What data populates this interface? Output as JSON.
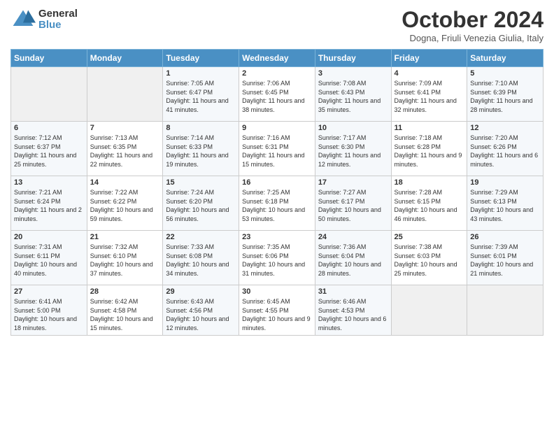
{
  "header": {
    "logo": {
      "general": "General",
      "blue": "Blue"
    },
    "title": "October 2024",
    "subtitle": "Dogna, Friuli Venezia Giulia, Italy"
  },
  "weekdays": [
    "Sunday",
    "Monday",
    "Tuesday",
    "Wednesday",
    "Thursday",
    "Friday",
    "Saturday"
  ],
  "weeks": [
    [
      {
        "day": "",
        "content": ""
      },
      {
        "day": "",
        "content": ""
      },
      {
        "day": "1",
        "content": "Sunrise: 7:05 AM\nSunset: 6:47 PM\nDaylight: 11 hours and 41 minutes."
      },
      {
        "day": "2",
        "content": "Sunrise: 7:06 AM\nSunset: 6:45 PM\nDaylight: 11 hours and 38 minutes."
      },
      {
        "day": "3",
        "content": "Sunrise: 7:08 AM\nSunset: 6:43 PM\nDaylight: 11 hours and 35 minutes."
      },
      {
        "day": "4",
        "content": "Sunrise: 7:09 AM\nSunset: 6:41 PM\nDaylight: 11 hours and 32 minutes."
      },
      {
        "day": "5",
        "content": "Sunrise: 7:10 AM\nSunset: 6:39 PM\nDaylight: 11 hours and 28 minutes."
      }
    ],
    [
      {
        "day": "6",
        "content": "Sunrise: 7:12 AM\nSunset: 6:37 PM\nDaylight: 11 hours and 25 minutes."
      },
      {
        "day": "7",
        "content": "Sunrise: 7:13 AM\nSunset: 6:35 PM\nDaylight: 11 hours and 22 minutes."
      },
      {
        "day": "8",
        "content": "Sunrise: 7:14 AM\nSunset: 6:33 PM\nDaylight: 11 hours and 19 minutes."
      },
      {
        "day": "9",
        "content": "Sunrise: 7:16 AM\nSunset: 6:31 PM\nDaylight: 11 hours and 15 minutes."
      },
      {
        "day": "10",
        "content": "Sunrise: 7:17 AM\nSunset: 6:30 PM\nDaylight: 11 hours and 12 minutes."
      },
      {
        "day": "11",
        "content": "Sunrise: 7:18 AM\nSunset: 6:28 PM\nDaylight: 11 hours and 9 minutes."
      },
      {
        "day": "12",
        "content": "Sunrise: 7:20 AM\nSunset: 6:26 PM\nDaylight: 11 hours and 6 minutes."
      }
    ],
    [
      {
        "day": "13",
        "content": "Sunrise: 7:21 AM\nSunset: 6:24 PM\nDaylight: 11 hours and 2 minutes."
      },
      {
        "day": "14",
        "content": "Sunrise: 7:22 AM\nSunset: 6:22 PM\nDaylight: 10 hours and 59 minutes."
      },
      {
        "day": "15",
        "content": "Sunrise: 7:24 AM\nSunset: 6:20 PM\nDaylight: 10 hours and 56 minutes."
      },
      {
        "day": "16",
        "content": "Sunrise: 7:25 AM\nSunset: 6:18 PM\nDaylight: 10 hours and 53 minutes."
      },
      {
        "day": "17",
        "content": "Sunrise: 7:27 AM\nSunset: 6:17 PM\nDaylight: 10 hours and 50 minutes."
      },
      {
        "day": "18",
        "content": "Sunrise: 7:28 AM\nSunset: 6:15 PM\nDaylight: 10 hours and 46 minutes."
      },
      {
        "day": "19",
        "content": "Sunrise: 7:29 AM\nSunset: 6:13 PM\nDaylight: 10 hours and 43 minutes."
      }
    ],
    [
      {
        "day": "20",
        "content": "Sunrise: 7:31 AM\nSunset: 6:11 PM\nDaylight: 10 hours and 40 minutes."
      },
      {
        "day": "21",
        "content": "Sunrise: 7:32 AM\nSunset: 6:10 PM\nDaylight: 10 hours and 37 minutes."
      },
      {
        "day": "22",
        "content": "Sunrise: 7:33 AM\nSunset: 6:08 PM\nDaylight: 10 hours and 34 minutes."
      },
      {
        "day": "23",
        "content": "Sunrise: 7:35 AM\nSunset: 6:06 PM\nDaylight: 10 hours and 31 minutes."
      },
      {
        "day": "24",
        "content": "Sunrise: 7:36 AM\nSunset: 6:04 PM\nDaylight: 10 hours and 28 minutes."
      },
      {
        "day": "25",
        "content": "Sunrise: 7:38 AM\nSunset: 6:03 PM\nDaylight: 10 hours and 25 minutes."
      },
      {
        "day": "26",
        "content": "Sunrise: 7:39 AM\nSunset: 6:01 PM\nDaylight: 10 hours and 21 minutes."
      }
    ],
    [
      {
        "day": "27",
        "content": "Sunrise: 6:41 AM\nSunset: 5:00 PM\nDaylight: 10 hours and 18 minutes."
      },
      {
        "day": "28",
        "content": "Sunrise: 6:42 AM\nSunset: 4:58 PM\nDaylight: 10 hours and 15 minutes."
      },
      {
        "day": "29",
        "content": "Sunrise: 6:43 AM\nSunset: 4:56 PM\nDaylight: 10 hours and 12 minutes."
      },
      {
        "day": "30",
        "content": "Sunrise: 6:45 AM\nSunset: 4:55 PM\nDaylight: 10 hours and 9 minutes."
      },
      {
        "day": "31",
        "content": "Sunrise: 6:46 AM\nSunset: 4:53 PM\nDaylight: 10 hours and 6 minutes."
      },
      {
        "day": "",
        "content": ""
      },
      {
        "day": "",
        "content": ""
      }
    ]
  ]
}
